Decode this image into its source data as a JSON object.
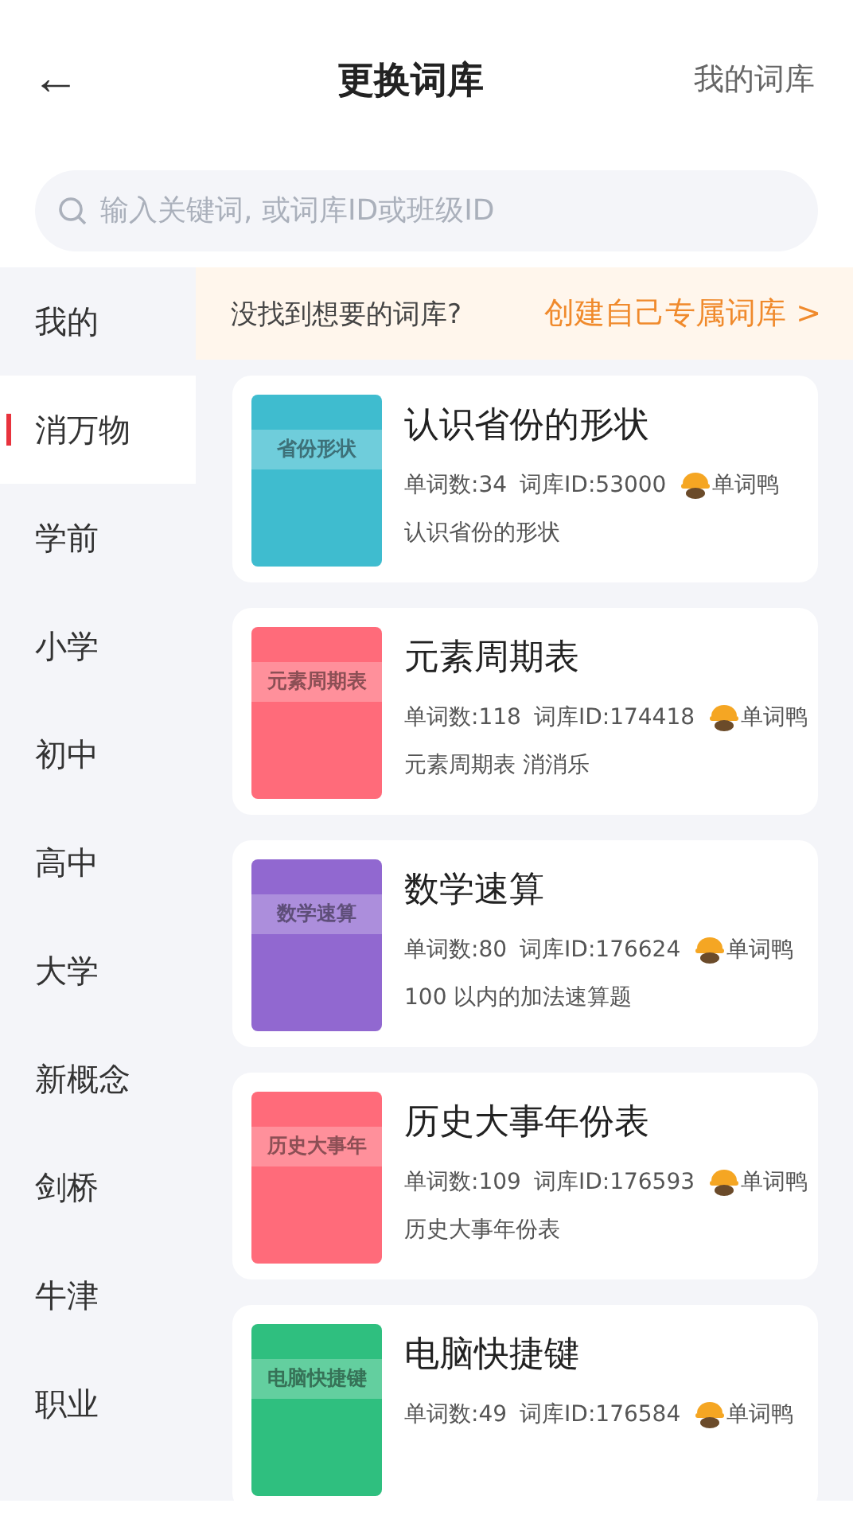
{
  "header": {
    "back_icon": "←",
    "title": "更换词库",
    "action": "我的词库"
  },
  "search": {
    "placeholder": "输入关键词, 或词库ID或班级ID"
  },
  "sidebar": {
    "items": [
      {
        "label": "我的",
        "selected": false
      },
      {
        "label": "消万物",
        "selected": true
      },
      {
        "label": "学前",
        "selected": false
      },
      {
        "label": "小学",
        "selected": false
      },
      {
        "label": "初中",
        "selected": false
      },
      {
        "label": "高中",
        "selected": false
      },
      {
        "label": "大学",
        "selected": false
      },
      {
        "label": "新概念",
        "selected": false
      },
      {
        "label": "剑桥",
        "selected": false
      },
      {
        "label": "牛津",
        "selected": false
      },
      {
        "label": "职业",
        "selected": false
      }
    ]
  },
  "banner": {
    "text": "没找到想要的词库?",
    "link": "创建自己专属词库 >"
  },
  "books": [
    {
      "title": "认识省份的形状",
      "cover_text": "省份形状",
      "color": "#3fbccf",
      "count": "单词数:34",
      "id": "词库ID:53000",
      "author": "单词鸭",
      "description": "认识省份的形状"
    },
    {
      "title": "元素周期表",
      "cover_text": "元素周期表",
      "color": "#ff6b7a",
      "count": "单词数:118",
      "id": "词库ID:174418",
      "author": "单词鸭",
      "description": "元素周期表 消消乐"
    },
    {
      "title": "数学速算",
      "cover_text": "数学速算",
      "color": "#9168d0",
      "count": "单词数:80",
      "id": "词库ID:176624",
      "author": "单词鸭",
      "description": "100 以内的加法速算题"
    },
    {
      "title": "历史大事年份表",
      "cover_text": "历史大事年",
      "color": "#ff6b7a",
      "count": "单词数:109",
      "id": "词库ID:176593",
      "author": "单词鸭",
      "description": "历史大事年份表"
    },
    {
      "title": "电脑快捷键",
      "cover_text": "电脑快捷键",
      "color": "#2fbf7f",
      "count": "单词数:49",
      "id": "词库ID:176584",
      "author": "单词鸭"
    }
  ]
}
